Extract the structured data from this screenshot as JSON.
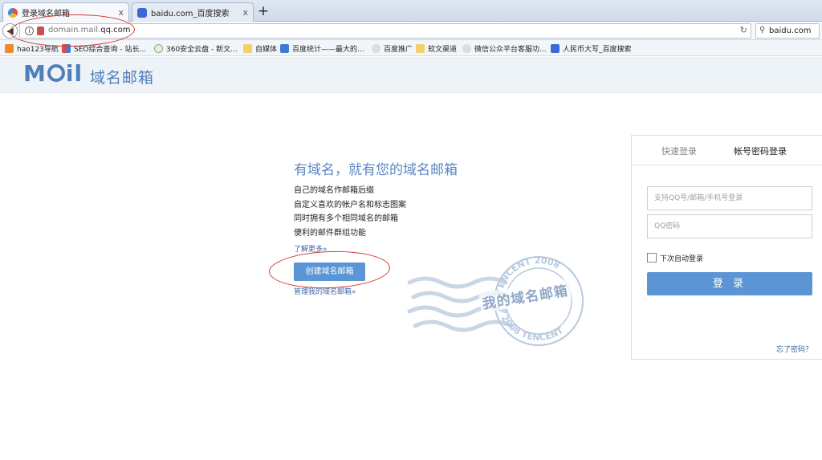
{
  "browser": {
    "tabs": [
      {
        "label": "登录域名邮箱",
        "active": true,
        "icon": "qq-browser-icon"
      },
      {
        "label": "baidu.com_百度搜索",
        "active": false,
        "icon": "baidu-paw-icon"
      }
    ],
    "close_glyph": "x",
    "new_tab_glyph": "+",
    "url": {
      "prefix": "domain.mail.",
      "host": "qq.com"
    },
    "search_value": "baidu.com",
    "bookmarks": [
      "hao123导航",
      "SEO综合查询 - 站长...",
      "360安全云盘 - 新文...",
      "自媒体",
      "百度统计——最大的...",
      "百度推广",
      "软文渠道",
      "微信公众平台客服功...",
      "人民币大写_百度搜索"
    ]
  },
  "header": {
    "logo_text_left": "M",
    "logo_text_right": "il",
    "logo_cn": "域名邮箱"
  },
  "promo": {
    "title": "有域名，就有您的域名邮箱",
    "features": [
      "自己的域名作邮箱后缀",
      "自定义喜欢的帐户名和标志图案",
      "同时拥有多个相同域名的邮箱",
      "便利的邮件群组功能"
    ],
    "learn_more": "了解更多»",
    "create_button": "创建域名邮箱",
    "manage_link": "管理我的域名邮箱»"
  },
  "stamp": {
    "center_text": "我的域名邮箱",
    "ring_top": "TENCENT 2008",
    "ring_bottom": "2008 TENCENT"
  },
  "login": {
    "tabs": [
      "快速登录",
      "帐号密码登录"
    ],
    "active_tab": "帐号密码登录",
    "username_placeholder": "支持QQ号/邮箱/手机号登录",
    "password_placeholder": "QQ密码",
    "auto_login_label": "下次自动登录",
    "login_button": "登 录",
    "forgot_link": "忘了密码？"
  },
  "colors": {
    "brand": "#4f7fb8",
    "button": "#5b95d6",
    "annotation": "#d23a32"
  }
}
